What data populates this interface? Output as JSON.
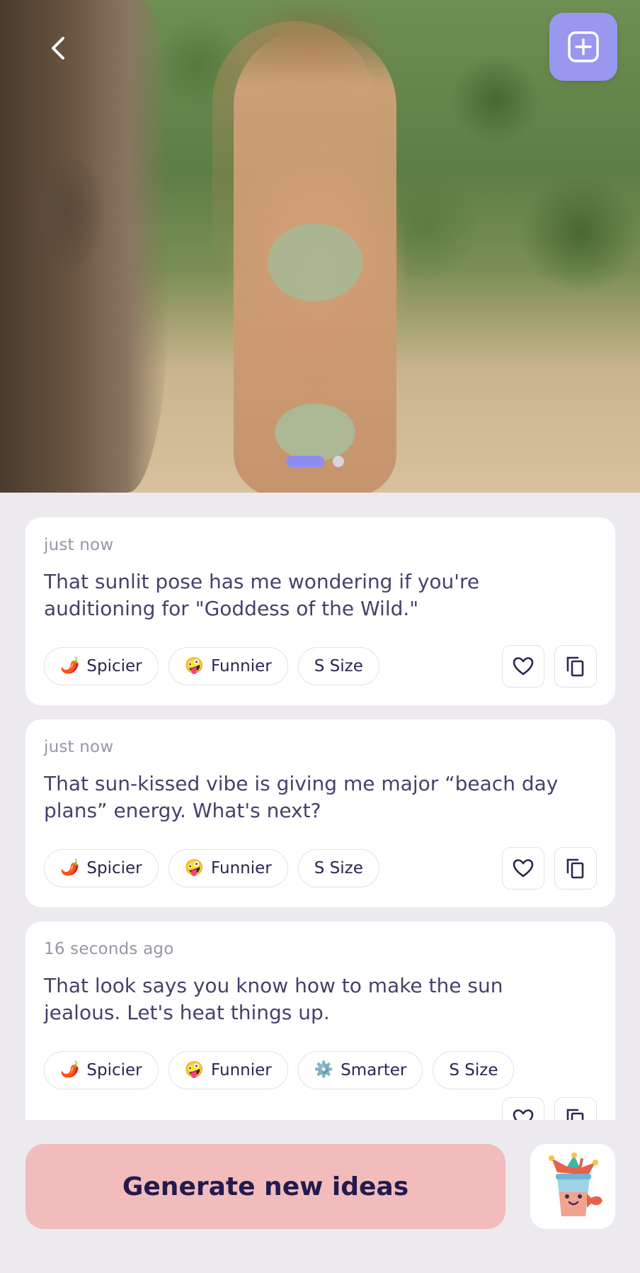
{
  "header": {
    "back_icon": "chevron-left-icon",
    "add_icon": "plus-square-icon",
    "accent_color": "#9a97f0"
  },
  "carousel": {
    "active_index": 0,
    "count": 2
  },
  "cards": [
    {
      "time": "just now",
      "message": "That sunlit pose has me wondering if you're auditioning for \"Goddess of the Wild.\"",
      "chips": [
        {
          "emoji": "🌶️",
          "label": "Spicier"
        },
        {
          "emoji": "🤪",
          "label": "Funnier"
        },
        {
          "emoji": "",
          "label": "S Size"
        }
      ]
    },
    {
      "time": "just now",
      "message": "That sun-kissed vibe is giving me major “beach day plans” energy. What's next?",
      "chips": [
        {
          "emoji": "🌶️",
          "label": "Spicier"
        },
        {
          "emoji": "🤪",
          "label": "Funnier"
        },
        {
          "emoji": "",
          "label": "S Size"
        }
      ]
    },
    {
      "time": "16 seconds ago",
      "message": "That look says you know how to make the sun jealous. Let's heat things up.",
      "chips": [
        {
          "emoji": "🌶️",
          "label": "Spicier"
        },
        {
          "emoji": "🤪",
          "label": "Funnier"
        },
        {
          "emoji": "⚙️",
          "label": "Smarter"
        },
        {
          "emoji": "",
          "label": "S Size"
        }
      ]
    }
  ],
  "footer": {
    "generate_label": "Generate new ideas",
    "generate_color": "#f2bcbc",
    "mascot_icon": "jester-cup-mascot-icon"
  }
}
